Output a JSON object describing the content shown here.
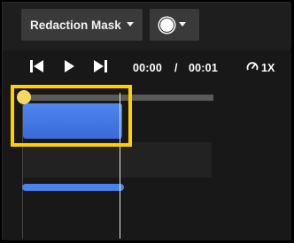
{
  "toolbar": {
    "mask_type": {
      "label": "Redaction Mask",
      "icon": "chevron-down-icon"
    },
    "color_picker": {
      "color": "#ffffff",
      "icon": "chevron-down-icon"
    }
  },
  "playback": {
    "buttons": [
      "skip-back-icon",
      "play-icon",
      "skip-forward-icon"
    ],
    "current_time": "00:00",
    "separator": "/",
    "duration": "00:01",
    "speed_icon": "speedometer-icon",
    "speed": "1X"
  },
  "timeline": {
    "playhead_time_fraction": 0.5,
    "colors": {
      "mask": "#3f74e2",
      "highlight": "#ffcf00",
      "knob": "#f6d860"
    }
  }
}
